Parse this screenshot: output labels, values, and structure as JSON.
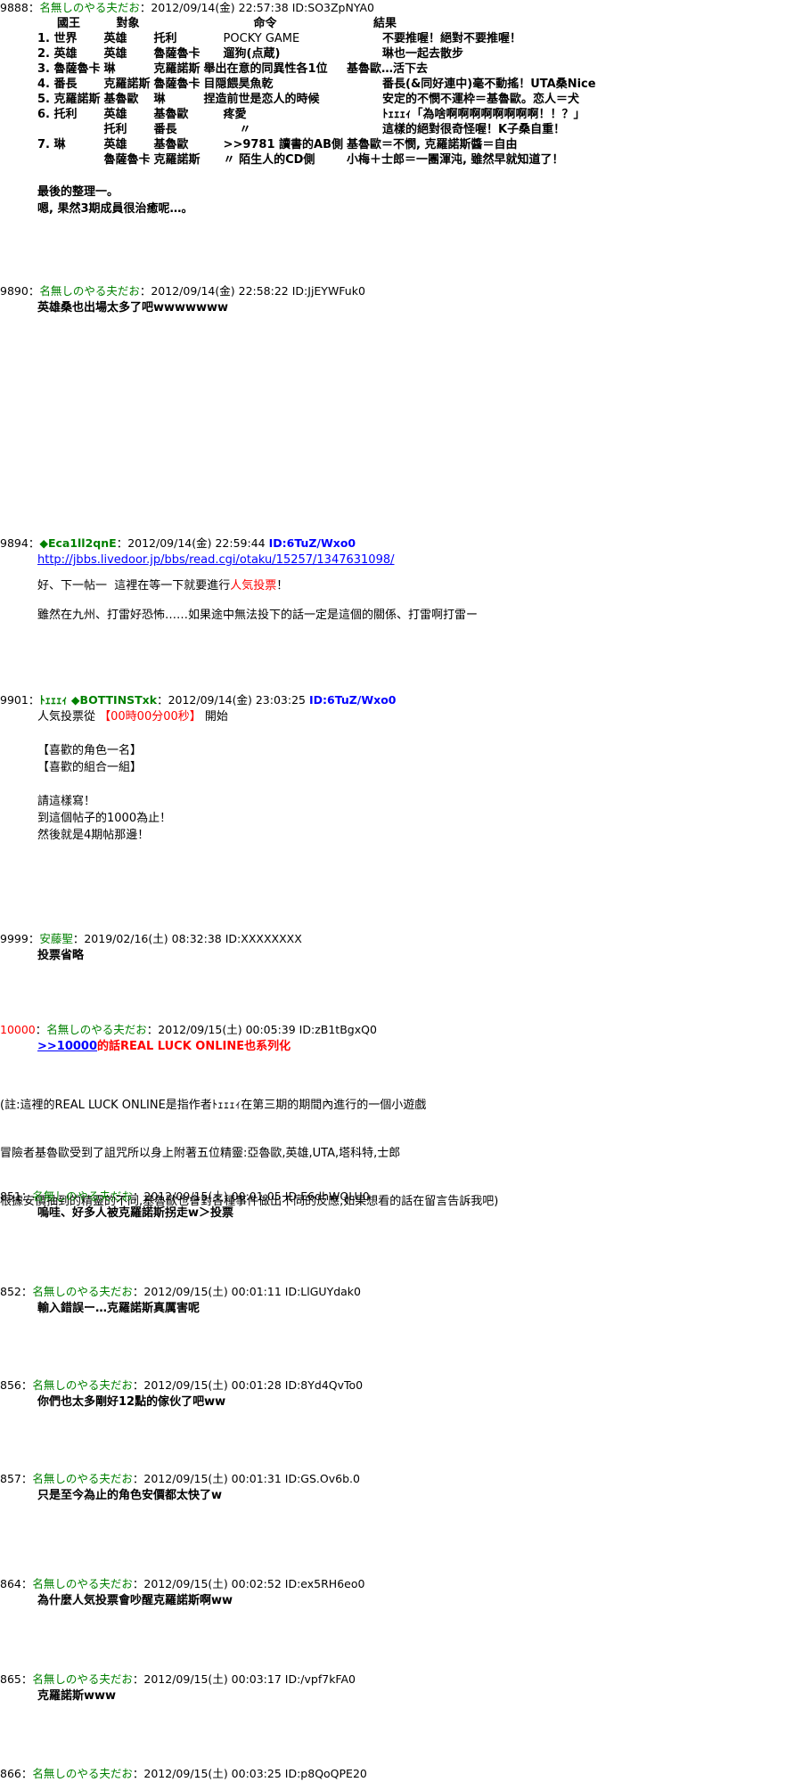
{
  "posts": [
    {
      "num": "9888",
      "sep": "：",
      "name": "名無しのやる夫だお",
      "meta": "：2012/09/14(金) 22:57:38 ID:SO3ZpNYA0",
      "table_header": [
        "國王",
        "對象",
        "命令",
        "結果"
      ],
      "rows": [
        [
          "1. 世界",
          "英雄",
          "托利",
          "POCKY GAME",
          "不要推喔！絕對不要推喔！"
        ],
        [
          "2. 英雄",
          "英雄",
          "魯薩魯卡",
          "遛狗(点蔵)",
          "琳也一起去散步"
        ],
        [
          "3. 魯薩魯卡",
          "琳",
          "克羅諾斯",
          "舉出在意的同異性各1位",
          "基魯歐…活下去"
        ],
        [
          "4. 番長",
          "克羅諾斯",
          "魯薩魯卡",
          "目隠餵昊魚乾",
          "番長(&同好連中)毫不動搖！UTA桑Nice"
        ],
        [
          "5. 克羅諾斯",
          "基魯歐",
          "琳",
          "捏造前世是恋人的時候",
          "安定的不憫不運枠＝基魯歐。恋人＝犬"
        ],
        [
          "6. 托利",
          "英雄",
          "基魯歐",
          "疼愛",
          "ﾄｪｪｪｨ「為啥啊啊啊啊啊啊啊啊！！？」"
        ],
        [
          "",
          "托利",
          "番長",
          "〃",
          "這樣的絕對很奇怪喔！K子桑自重！"
        ],
        [
          "7. 琳",
          "英雄",
          "基魯歐",
          ">>9781 讀書的AB側",
          "基魯歐＝不憫, 克羅諾斯醬＝自由"
        ],
        [
          "",
          "魯薩魯卡",
          "克羅諾斯",
          "〃 陌生人的CD側",
          "小梅＋士郎＝一團渾沌, 雖然早就知道了！"
        ]
      ],
      "lines": [
        "最後的整理一。",
        "嗯, 果然3期成員很治癒呢…。"
      ]
    },
    {
      "num": "9890",
      "sep": "：",
      "name": "名無しのやる夫だお",
      "meta": "：2012/09/14(金) 22:58:22 ID:JjEYWFuk0",
      "lines": [
        "英雄桑也出場太多了吧wwwwwww"
      ]
    },
    {
      "num": "9894",
      "sep": "：",
      "name": "◆Eca1ll2qnE",
      "meta": "：2012/09/14(金) 22:59:44",
      "id": "ID:6TuZ/Wxo0",
      "link": "http://jbbs.livedoor.jp/bbs/read.cgi/otaku/15257/1347631098/",
      "line1a": "好、下一帖一  這裡在等一下就要進行",
      "line1b": "人気投票",
      "line1c": "！",
      "line2": "雖然在九州、打雷好恐怖……如果途中無法投下的話一定是這個的關係、打雷啊打雷ー"
    },
    {
      "num": "9901",
      "sep": "：",
      "name": "ﾄｪｪｪｨ ◆BOTTINSTxk",
      "meta": "：2012/09/14(金) 23:03:25",
      "id": "ID:6TuZ/Wxo0",
      "line1a": "人気投票從 ",
      "line1b": "【00時00分00秒】",
      "line1c": " 開始",
      "lines": [
        "",
        "【喜歡的角色一名】",
        "【喜歡的組合一組】",
        "",
        "請這樣寫！",
        "到這個帖子的1000為止！",
        "然後就是4期帖那邊！"
      ]
    },
    {
      "num": "9999",
      "sep": "：",
      "name": "安藤聖",
      "meta": "：2019/02/16(土) 08:32:38 ID:XXXXXXXX",
      "lines": [
        "投票省略"
      ]
    },
    {
      "num": "10000",
      "sep": "：",
      "name": "名無しのやる夫だお",
      "meta": "：2012/09/15(土) 00:05:39 ID:zB1tBgxQ0",
      "anchor": ">>10000",
      "red_line": "的話REAL LUCK ONLINE也系列化"
    },
    {
      "note": [
        "(註:這裡的REAL LUCK ONLINE是指作者ﾄｪｪｪｨ在第三期的期間內進行的一個小遊戲",
        "冒險者基魯歐受到了詛咒所以身上附著五位精靈:亞魯歐,英雄,UTA,塔科特,士郎",
        "根據安價抽到的精靈的不同,基魯歐也會對各種事件做出不同的反應,如果想看的話在留言告訴我吧)"
      ]
    },
    {
      "num": "851",
      "sep": "：",
      "name": "名無しのやる夫だお",
      "meta": "：2012/09/15(土) 00:01:05 ID:E6dhWQLU0",
      "lines": [
        "嗚哇、好多人被克羅諾斯拐走w＞投票"
      ]
    },
    {
      "num": "852",
      "sep": "：",
      "name": "名無しのやる夫だお",
      "meta": "：2012/09/15(土) 00:01:11 ID:LlGUYdak0",
      "lines": [
        "輸入錯誤ー…克羅諾斯真厲害呢"
      ]
    },
    {
      "num": "856",
      "sep": "：",
      "name": "名無しのやる夫だお",
      "meta": "：2012/09/15(土) 00:01:28 ID:8Yd4QvTo0",
      "lines": [
        "你們也太多剛好12點的傢伙了吧ww"
      ]
    },
    {
      "num": "857",
      "sep": "：",
      "name": "名無しのやる夫だお",
      "meta": "：2012/09/15(土) 00:01:31 ID:GS.Ov6b.0",
      "lines": [
        "只是至今為止的角色安價都太快了w"
      ]
    },
    {
      "num": "864",
      "sep": "：",
      "name": "名無しのやる夫だお",
      "meta": "：2012/09/15(土) 00:02:52 ID:ex5RH6eo0",
      "lines": [
        "為什麼人気投票會吵醒克羅諾斯啊ww"
      ]
    },
    {
      "num": "865",
      "sep": "：",
      "name": "名無しのやる夫だお",
      "meta": "：2012/09/15(土) 00:03:17 ID:/vpf7kFA0",
      "lines": [
        "克羅諾斯www"
      ]
    },
    {
      "num": "866",
      "sep": "：",
      "name": "名無しのやる夫だお",
      "meta": "：2012/09/15(土) 00:03:25 ID:p8QoQPE20"
    }
  ]
}
